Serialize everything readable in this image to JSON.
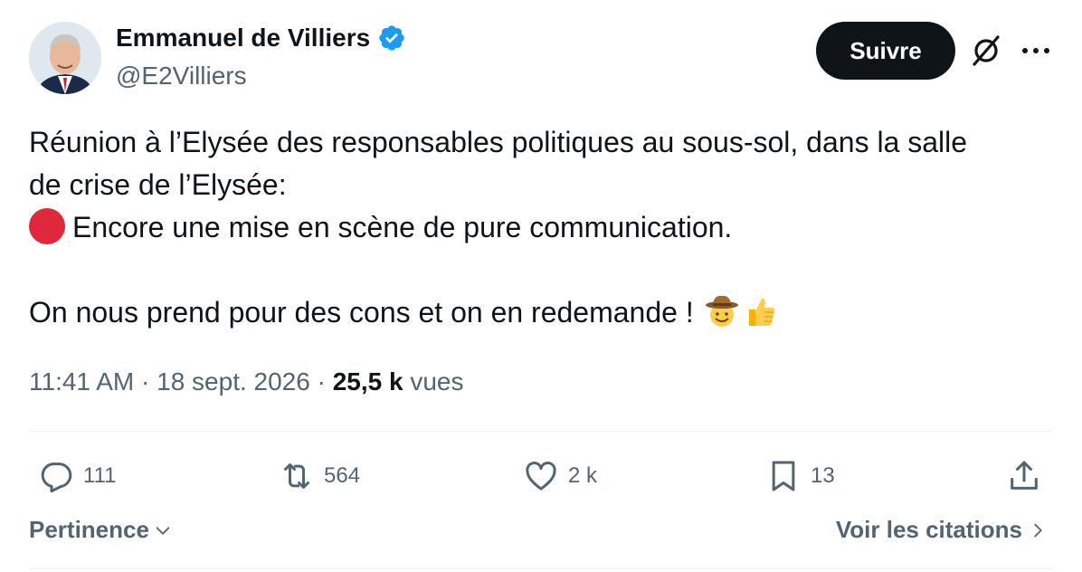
{
  "author": {
    "name": "Emmanuel de Villiers",
    "handle": "@E2Villiers",
    "verified": true
  },
  "header": {
    "follow_label": "Suivre",
    "icons": [
      "grok-icon",
      "more-icon"
    ]
  },
  "tweet": {
    "line1": "Réunion à l’Elysée des responsables politiques au sous-sol, dans la salle",
    "line2": "de crise de l’Elysée:",
    "line3": "Encore une mise en scène de pure communication.",
    "line4": "On nous prend pour des cons et on en redemande !"
  },
  "meta": {
    "time": "11:41 AM",
    "sep1": " · ",
    "date": "18 sept. 2026",
    "sep2": " · ",
    "views_count": "25,5 k",
    "views_label": " vues"
  },
  "actions": {
    "replies": "111",
    "reposts": "564",
    "likes": "2 k",
    "bookmarks": "13"
  },
  "footer": {
    "sort_label": "Pertinence",
    "quotes_label": "Voir les citations"
  },
  "colors": {
    "text": "#0f1419",
    "secondary": "#536471",
    "verified_blue": "#1d9bf0",
    "button_bg": "#0f1419",
    "red_circle": "#e0283c"
  }
}
